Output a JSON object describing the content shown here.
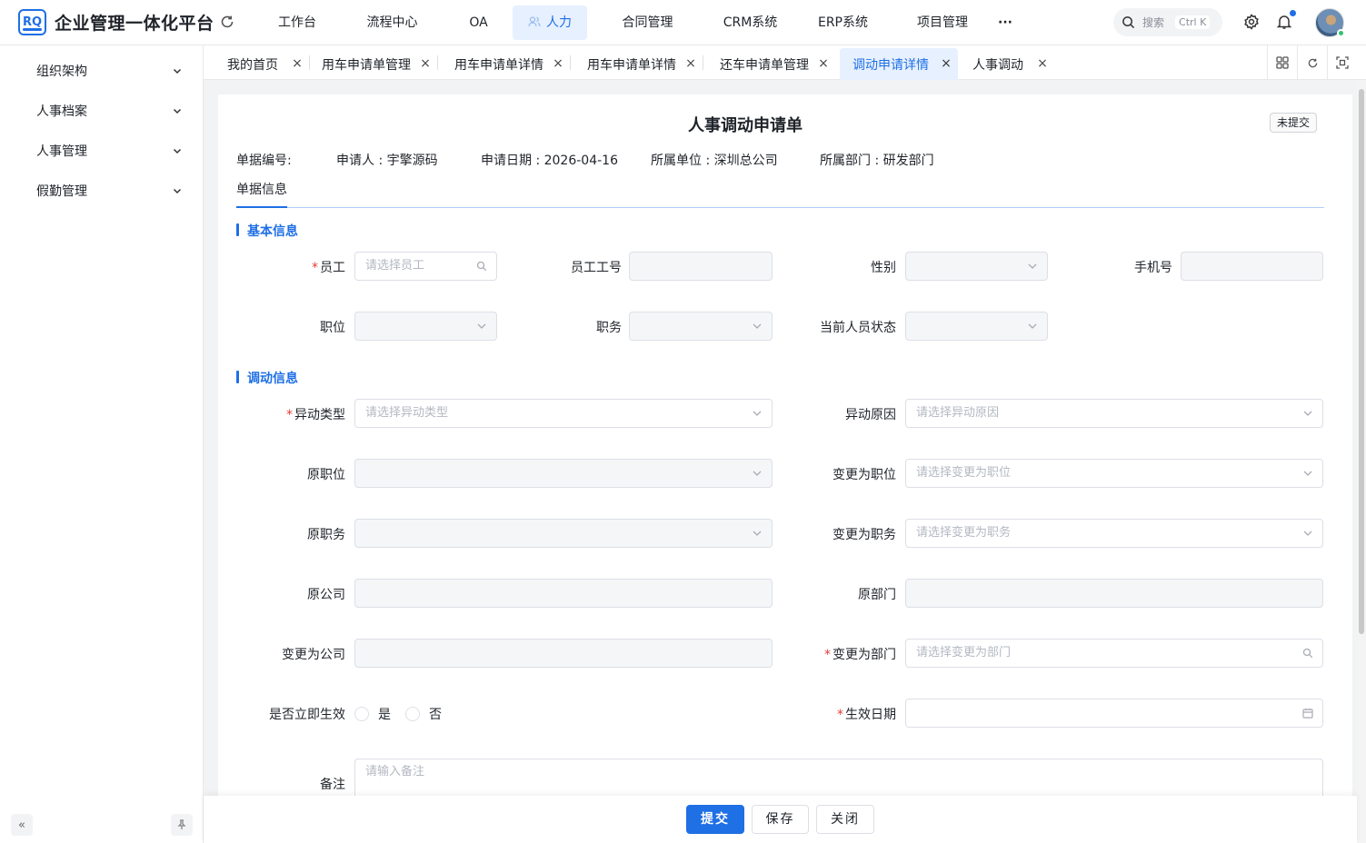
{
  "app": {
    "logo_text": "RQ",
    "title": "企业管理一体化平台"
  },
  "nav": {
    "items": [
      "工作台",
      "流程中心",
      "OA",
      "人力",
      "合同管理",
      "CRM系统",
      "ERP系统",
      "项目管理"
    ],
    "active": "人力",
    "more": "···"
  },
  "search": {
    "label": "搜索",
    "shortcut": "Ctrl K"
  },
  "sidebar": {
    "items": [
      "组织架构",
      "人事档案",
      "人事管理",
      "假勤管理"
    ]
  },
  "tabs": {
    "items": [
      "我的首页",
      "用车申请单管理",
      "用车申请单详情",
      "用车申请单详情",
      "还车申请单管理",
      "调动申请详情",
      "人事调动"
    ],
    "active": "调动申请详情"
  },
  "form": {
    "title": "人事调动申请单",
    "status": "未提交",
    "meta": {
      "doc_no": "单据编号:",
      "applicant": "申请人 : 宇擎源码",
      "apply_date": "申请日期 : 2026-04-16",
      "unit": "所属单位 : 深圳总公司",
      "dept": "所属部门 : 研发部门"
    },
    "sub_tab": "单据信息",
    "sections": {
      "basic": "基本信息",
      "transfer": "调动信息"
    },
    "fields": {
      "employee": {
        "label": "员工",
        "required": true,
        "placeholder": "请选择员工"
      },
      "employee_no": {
        "label": "员工工号"
      },
      "gender": {
        "label": "性别"
      },
      "phone": {
        "label": "手机号"
      },
      "position": {
        "label": "职位"
      },
      "duty": {
        "label": "职务"
      },
      "staff_status": {
        "label": "当前人员状态"
      },
      "change_type": {
        "label": "异动类型",
        "required": true,
        "placeholder": "请选择异动类型"
      },
      "change_reason": {
        "label": "异动原因",
        "placeholder": "请选择异动原因"
      },
      "orig_position": {
        "label": "原职位"
      },
      "new_position": {
        "label": "变更为职位",
        "placeholder": "请选择变更为职位"
      },
      "orig_duty": {
        "label": "原职务"
      },
      "new_duty": {
        "label": "变更为职务",
        "placeholder": "请选择变更为职务"
      },
      "orig_company": {
        "label": "原公司"
      },
      "orig_dept": {
        "label": "原部门"
      },
      "new_company": {
        "label": "变更为公司"
      },
      "new_dept": {
        "label": "变更为部门",
        "required": true,
        "placeholder": "请选择变更为部门"
      },
      "immediate": {
        "label": "是否立即生效",
        "options": [
          "是",
          "否"
        ]
      },
      "effective_date": {
        "label": "生效日期",
        "required": true
      },
      "remark": {
        "label": "备注",
        "placeholder": "请输入备注"
      }
    }
  },
  "footer": {
    "submit": "提交",
    "save": "保存",
    "close": "关闭"
  },
  "colors": {
    "primary": "#1f6fe5",
    "required": "#e23c39",
    "page_bg": "#f2f3f5"
  }
}
